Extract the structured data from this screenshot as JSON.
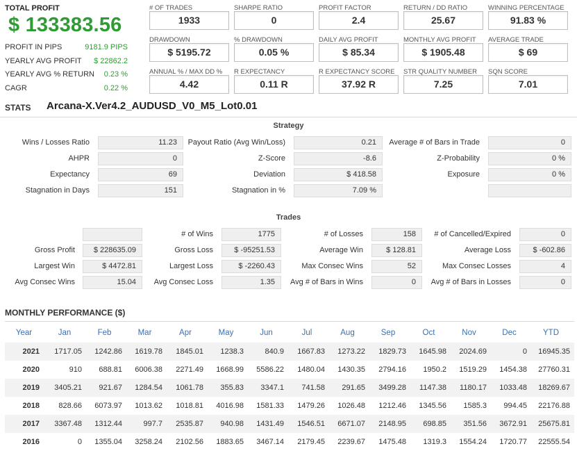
{
  "summary": {
    "total_profit_label": "TOTAL PROFIT",
    "total_profit_value": "$ 133383.56",
    "rows": [
      {
        "label": "PROFIT IN PIPS",
        "value": "9181.9 PIPS"
      },
      {
        "label": "YEARLY AVG PROFIT",
        "value": "$ 22862.2"
      },
      {
        "label": "YEARLY AVG % RETURN",
        "value": "0.23 %"
      },
      {
        "label": "CAGR",
        "value": "0.22 %"
      }
    ]
  },
  "metrics": [
    {
      "label": "# OF TRADES",
      "value": "1933"
    },
    {
      "label": "SHARPE RATIO",
      "value": "0"
    },
    {
      "label": "PROFIT FACTOR",
      "value": "2.4"
    },
    {
      "label": "RETURN / DD RATIO",
      "value": "25.67"
    },
    {
      "label": "WINNING PERCENTAGE",
      "value": "91.83 %"
    },
    {
      "label": "DRAWDOWN",
      "value": "$ 5195.72"
    },
    {
      "label": "% DRAWDOWN",
      "value": "0.05 %"
    },
    {
      "label": "DAILY AVG PROFIT",
      "value": "$ 85.34"
    },
    {
      "label": "MONTHLY AVG PROFIT",
      "value": "$ 1905.48"
    },
    {
      "label": "AVERAGE TRADE",
      "value": "$ 69"
    },
    {
      "label": "ANNUAL % / MAX DD %",
      "value": "4.42"
    },
    {
      "label": "R EXPECTANCY",
      "value": "0.11 R"
    },
    {
      "label": "R EXPECTANCY SCORE",
      "value": "37.92 R"
    },
    {
      "label": "STR QUALITY NUMBER",
      "value": "7.25"
    },
    {
      "label": "SQN SCORE",
      "value": "7.01"
    }
  ],
  "stats": {
    "label": "STATS",
    "strategy_name": "Arcana-X.Ver4.2_AUDUSD_V0_M5_Lot0.01"
  },
  "strategy": {
    "title": "Strategy",
    "rows": [
      [
        {
          "label": "Wins / Losses Ratio",
          "value": "11.23"
        },
        {
          "label": "Payout Ratio (Avg Win/Loss)",
          "value": "0.21"
        },
        {
          "label": "Average # of Bars in Trade",
          "value": "0"
        }
      ],
      [
        {
          "label": "AHPR",
          "value": "0"
        },
        {
          "label": "Z-Score",
          "value": "-8.6"
        },
        {
          "label": "Z-Probability",
          "value": "0 %"
        }
      ],
      [
        {
          "label": "Expectancy",
          "value": "69"
        },
        {
          "label": "Deviation",
          "value": "$ 418.58"
        },
        {
          "label": "Exposure",
          "value": "0 %"
        }
      ],
      [
        {
          "label": "Stagnation in Days",
          "value": "151"
        },
        {
          "label": "Stagnation in %",
          "value": "7.09 %"
        },
        {
          "label": "",
          "value": ""
        }
      ]
    ]
  },
  "trades": {
    "title": "Trades",
    "rows": [
      [
        {
          "label": "",
          "value": ""
        },
        {
          "label": "# of Wins",
          "value": "1775"
        },
        {
          "label": "# of Losses",
          "value": "158"
        },
        {
          "label": "# of Cancelled/Expired",
          "value": "0"
        }
      ],
      [
        {
          "label": "Gross Profit",
          "value": "$ 228635.09"
        },
        {
          "label": "Gross Loss",
          "value": "$ -95251.53"
        },
        {
          "label": "Average Win",
          "value": "$ 128.81"
        },
        {
          "label": "Average Loss",
          "value": "$ -602.86"
        }
      ],
      [
        {
          "label": "Largest Win",
          "value": "$ 4472.81"
        },
        {
          "label": "Largest Loss",
          "value": "$ -2260.43"
        },
        {
          "label": "Max Consec Wins",
          "value": "52"
        },
        {
          "label": "Max Consec Losses",
          "value": "4"
        }
      ],
      [
        {
          "label": "Avg Consec Wins",
          "value": "15.04"
        },
        {
          "label": "Avg Consec Loss",
          "value": "1.35"
        },
        {
          "label": "Avg # of Bars in Wins",
          "value": "0"
        },
        {
          "label": "Avg # of Bars in Losses",
          "value": "0"
        }
      ]
    ]
  },
  "monthly": {
    "title": "MONTHLY PERFORMANCE ($)",
    "headers": [
      "Year",
      "Jan",
      "Feb",
      "Mar",
      "Apr",
      "May",
      "Jun",
      "Jul",
      "Aug",
      "Sep",
      "Oct",
      "Nov",
      "Dec",
      "YTD"
    ],
    "rows": [
      [
        "2021",
        "1717.05",
        "1242.86",
        "1619.78",
        "1845.01",
        "1238.3",
        "840.9",
        "1667.83",
        "1273.22",
        "1829.73",
        "1645.98",
        "2024.69",
        "0",
        "16945.35"
      ],
      [
        "2020",
        "910",
        "688.81",
        "6006.38",
        "2271.49",
        "1668.99",
        "5586.22",
        "1480.04",
        "1430.35",
        "2794.16",
        "1950.2",
        "1519.29",
        "1454.38",
        "27760.31"
      ],
      [
        "2019",
        "3405.21",
        "921.67",
        "1284.54",
        "1061.78",
        "355.83",
        "3347.1",
        "741.58",
        "291.65",
        "3499.28",
        "1147.38",
        "1180.17",
        "1033.48",
        "18269.67"
      ],
      [
        "2018",
        "828.66",
        "6073.97",
        "1013.62",
        "1018.81",
        "4016.98",
        "1581.33",
        "1479.26",
        "1026.48",
        "1212.46",
        "1345.56",
        "1585.3",
        "994.45",
        "22176.88"
      ],
      [
        "2017",
        "3367.48",
        "1312.44",
        "997.7",
        "2535.87",
        "940.98",
        "1431.49",
        "1546.51",
        "6671.07",
        "2148.95",
        "698.85",
        "351.56",
        "3672.91",
        "25675.81"
      ],
      [
        "2016",
        "0",
        "1355.04",
        "3258.24",
        "2102.56",
        "1883.65",
        "3467.14",
        "2179.45",
        "2239.67",
        "1475.48",
        "1319.3",
        "1554.24",
        "1720.77",
        "22555.54"
      ]
    ]
  }
}
